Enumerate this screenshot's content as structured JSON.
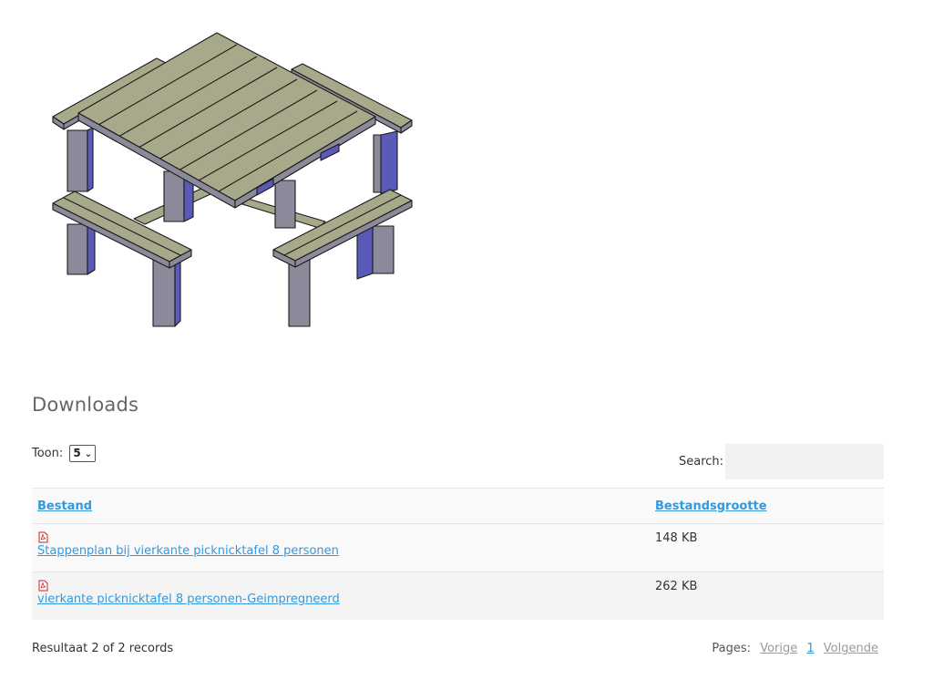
{
  "image": {
    "alt": "vierkante picknicktafel 8 personen"
  },
  "downloads": {
    "title": "Downloads",
    "length_label": "Toon:",
    "length_value": "5",
    "search_label": "Search:",
    "search_placeholder": "",
    "columns": [
      "Bestand",
      "Bestandsgrootte"
    ],
    "rows": [
      {
        "icon": "pdf-icon",
        "name": "Stappenplan bij vierkante picknicktafel 8 personen",
        "size": "148 KB"
      },
      {
        "icon": "pdf-icon",
        "name": "vierkante picknicktafel 8 personen-Geimpregneerd",
        "size": "262 KB"
      }
    ],
    "info": "Resultaat 2 of 2 records",
    "pagination": {
      "label": "Pages:",
      "prev": "Vorige",
      "page": "1",
      "next": "Volgende"
    }
  },
  "colors": {
    "wood_top": "#a8a98a",
    "wood_side": "#8687a2",
    "wood_dark": "#5a5ab8",
    "link": "#3399dd"
  }
}
